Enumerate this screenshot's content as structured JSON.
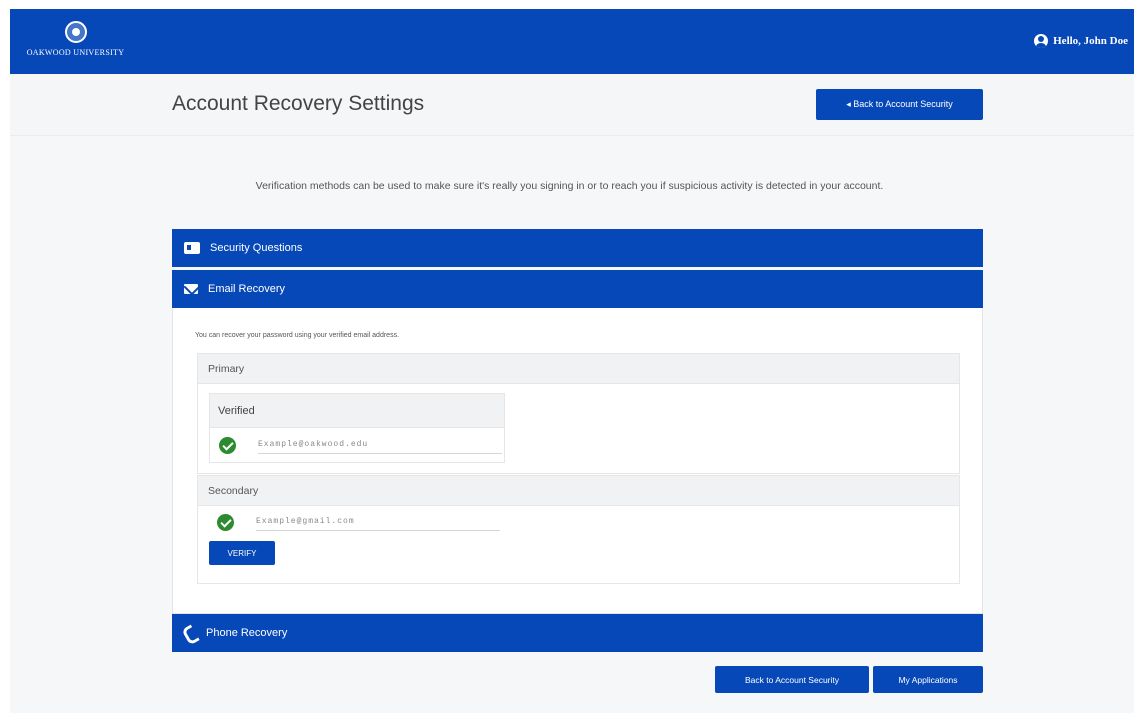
{
  "header": {
    "logo_text": "OAKWOOD UNIVERSITY",
    "user_greeting": "Hello, John Doe",
    "brand_color": "#0748b8"
  },
  "subheader": {
    "title": "Account Recovery Settings",
    "back_button_label": "◂ Back to Account Security"
  },
  "intro_text": "Verification methods can be used to make sure it's really you signing in or to reach you if suspicious activity is detected in your account.",
  "sections": {
    "security_questions": {
      "label": "Security Questions",
      "icon": "id-card-icon"
    },
    "email_recovery": {
      "label": "Email Recovery",
      "icon": "envelope-icon",
      "note": "You can recover your password using your verified email address.",
      "primary": {
        "heading": "Primary",
        "status_heading": "Verified",
        "email": "Example@oakwood.edu"
      },
      "secondary": {
        "heading": "Secondary",
        "email": "Example@gmail.com",
        "verify_label": "VERIFY"
      }
    },
    "phone_recovery": {
      "label": "Phone Recovery",
      "icon": "phone-icon"
    }
  },
  "footer": {
    "back_recovery_label": "Back to Account Security",
    "my_apps_label": "My Applications"
  }
}
